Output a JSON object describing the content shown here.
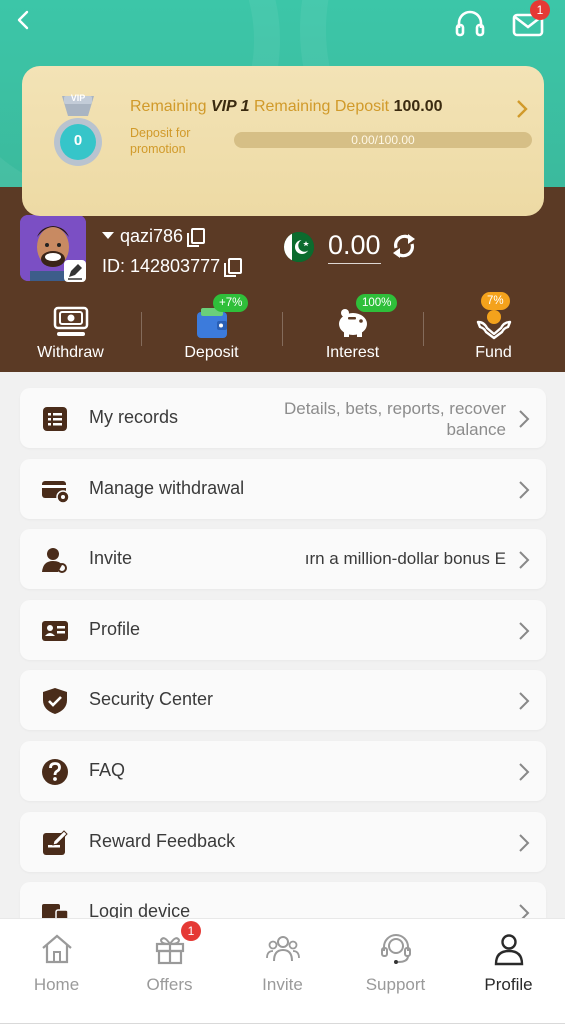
{
  "header": {
    "back_icon": "back-arrow-icon",
    "support_icon": "headset-icon",
    "mail_icon": "mail-icon",
    "mail_badge": "1"
  },
  "vip": {
    "remaining_label": "Remaining",
    "level": "VIP 1",
    "deposit_label": "Remaining Deposit",
    "deposit_value": "100.00",
    "medal_value": "0",
    "medal_label": "VIP",
    "subtitle": "Deposit for promotion",
    "progress_text": "0.00/100.00",
    "progress_fraction": 0.0
  },
  "user": {
    "username": "qazi786",
    "id_label": "ID: 142803777",
    "balance": "0.00"
  },
  "actions": [
    {
      "label": "Withdraw",
      "badge": ""
    },
    {
      "label": "Deposit",
      "badge": "+7%"
    },
    {
      "label": "Interest",
      "badge": "100%"
    },
    {
      "label": "Fund",
      "badge": "7%"
    }
  ],
  "menu": [
    {
      "label": "My records",
      "detail": "Details, bets, reports, recover balance"
    },
    {
      "label": "Manage withdrawal",
      "detail": ""
    },
    {
      "label": "Invite",
      "detail": "ırn a million-dollar bonus  E"
    },
    {
      "label": "Profile",
      "detail": ""
    },
    {
      "label": "Security Center",
      "detail": ""
    },
    {
      "label": "FAQ",
      "detail": ""
    },
    {
      "label": "Reward Feedback",
      "detail": ""
    },
    {
      "label": "Login device",
      "detail": ""
    }
  ],
  "tabs": [
    {
      "label": "Home"
    },
    {
      "label": "Offers",
      "badge": "1"
    },
    {
      "label": "Invite"
    },
    {
      "label": "Support"
    },
    {
      "label": "Profile"
    }
  ],
  "colors": {
    "header_green": "#3cc6a8",
    "panel_brown": "#5b3a25",
    "vip_gold": "#d19a2a",
    "badge_red": "#e53935",
    "pill_green": "#2fbf3a"
  }
}
